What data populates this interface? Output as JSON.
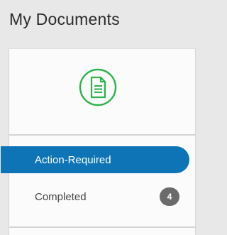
{
  "header": {
    "title": "My Documents"
  },
  "panel": {
    "icon": "document-icon",
    "accent_color": "#2bb34a",
    "nav": [
      {
        "label": "Action-Required",
        "active": true,
        "color": "#0e74b5"
      },
      {
        "label": "Completed",
        "badge": "4"
      }
    ]
  }
}
